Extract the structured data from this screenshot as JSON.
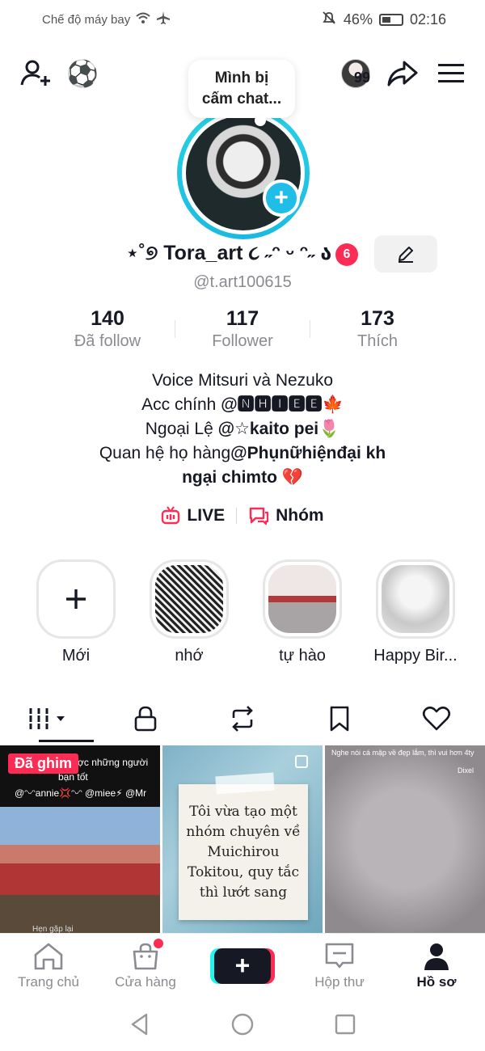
{
  "status_bar": {
    "airplane_text": "Chế độ máy bay",
    "battery": "46%",
    "time": "02:16"
  },
  "top_nav": {
    "inbox_count": "99"
  },
  "profile": {
    "bubble_line1": "Mình bị",
    "bubble_line2": "cấm chat...",
    "display_name": "⋆˚୭ Tora_art ૮ ˶ᵔ ᵕ ᵔ˶ ა",
    "name_badge": "6",
    "handle": "@t.art100615"
  },
  "stats": [
    {
      "value": "140",
      "label": "Đã follow"
    },
    {
      "value": "117",
      "label": "Follower"
    },
    {
      "value": "173",
      "label": "Thích"
    }
  ],
  "bio": {
    "line1": "Voice Mitsuri và Nezuko",
    "line2_prefix": "Acc chính ",
    "line2_mention": "@🅽🅷🅸🅴🅴",
    "line2_emoji": "🍁",
    "line3_prefix": "Ngoại Lệ ",
    "line3_mention": "@☆kaito pei",
    "line3_emoji": "🌷",
    "line4_prefix": "Quan hệ họ hàng",
    "line4_mention": "@Phụnữhiệnđại kh",
    "line5_mention": "ngại chimto",
    "line5_emoji": "💔"
  },
  "links": {
    "live": "LIVE",
    "group": "Nhóm"
  },
  "highlights": [
    {
      "label": "Mới"
    },
    {
      "label": "nhớ"
    },
    {
      "label": "tự hào"
    },
    {
      "label": "Happy Bir..."
    }
  ],
  "videos": {
    "pinned_label": "Đã ghim",
    "v1_caption": "ược những người",
    "v1_caption2": "bạn tốt",
    "v1_tags": "@ᵔᵕᵔannie💢ᵔᵕᵔ @miee⚡ @Mr",
    "v1_footer": "Hẹn gặp lại",
    "v2_note": "Tôi vừa tạo một nhóm chuyên về Muichirou Tokitou, quy tắc thì lướt sang",
    "v3_caption": "Nghe nói cá mập về đẹp lắm, thì vui hơn 4ty",
    "v3_caption2": "Dixel"
  },
  "bottom_nav": {
    "home": "Trang chủ",
    "shop": "Cửa hàng",
    "inbox": "Hộp thư",
    "profile": "Hồ sơ"
  },
  "colors": {
    "accent_red": "#fe2c55",
    "accent_cyan": "#25f4ee",
    "ring_blue": "#20bde6"
  }
}
